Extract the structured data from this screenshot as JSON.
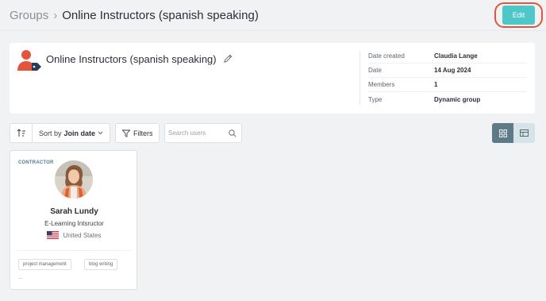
{
  "breadcrumb": {
    "root": "Groups",
    "separator": "›",
    "current": "Online Instructors (spanish speaking)"
  },
  "header": {
    "edit_label": "Edit"
  },
  "group": {
    "name": "Online Instructors (spanish speaking)",
    "icon": "user-tag-icon",
    "meta": [
      {
        "key": "Date created",
        "value": "Claudia Lange"
      },
      {
        "key": "Date",
        "value": "14 Aug 2024"
      },
      {
        "key": "Members",
        "value": "1"
      },
      {
        "key": "Type",
        "value": "Dynamic group"
      }
    ]
  },
  "toolbar": {
    "sort_prefix": "Sort by",
    "sort_value": "Join date",
    "filters_label": "Filters",
    "search_placeholder": "Search users"
  },
  "members": [
    {
      "role": "CONTRACTOR",
      "name": "Sarah Lundy",
      "title": "E-Learning Intsructor",
      "country": "United States",
      "tags": [
        "project management",
        "blog writing"
      ],
      "more": "..."
    }
  ],
  "colors": {
    "accent": "#4ec7c8",
    "highlight_ring": "#e5533d",
    "group_icon": "#e5533d",
    "view_active": "#5d7a86",
    "view_inactive": "#d5e4e8"
  }
}
